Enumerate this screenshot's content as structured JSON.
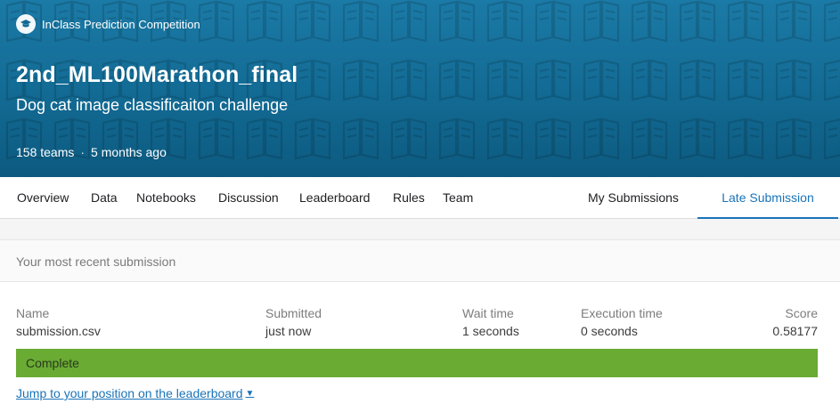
{
  "hero": {
    "badge": "InClass Prediction Competition",
    "badge_icon": "graduation-cap-icon",
    "title": "2nd_ML100Marathon_final",
    "subtitle": "Dog cat image classificaiton challenge",
    "teams": "158 teams",
    "separator": "·",
    "time": "5 months ago",
    "background_color": "#126a93"
  },
  "tabs": {
    "items": [
      "Overview",
      "Data",
      "Notebooks",
      "Discussion",
      "Leaderboard",
      "Rules",
      "Team"
    ],
    "right_items": [
      "My Submissions",
      "Late Submission"
    ],
    "active": "Late Submission",
    "accent_color": "#1a73b8"
  },
  "submission": {
    "header": "Your most recent submission",
    "columns": {
      "name": {
        "label": "Name",
        "value": "submission.csv"
      },
      "submitted": {
        "label": "Submitted",
        "value": "just now"
      },
      "wait": {
        "label": "Wait time",
        "value": "1 seconds"
      },
      "execution": {
        "label": "Execution time",
        "value": "0 seconds"
      },
      "score": {
        "label": "Score",
        "value": "0.58177"
      }
    },
    "status": "Complete",
    "status_color": "#6aab33",
    "jump_link": "Jump to your position on the leaderboard",
    "jump_icon": "caret-down-icon"
  }
}
